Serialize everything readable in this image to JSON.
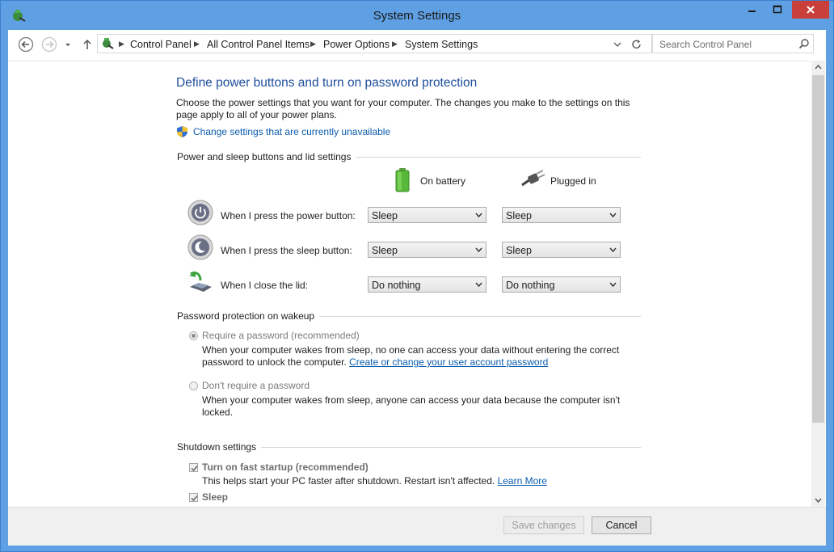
{
  "window": {
    "title": "System Settings"
  },
  "address": {
    "crumbs": [
      "Control Panel",
      "All Control Panel Items",
      "Power Options",
      "System Settings"
    ],
    "search_placeholder": "Search Control Panel"
  },
  "page": {
    "heading": "Define power buttons and turn on password protection",
    "intro_line1": "Choose the power settings that you want for your computer. The changes you make to the settings on this",
    "intro_line2": "page apply to all of your power plans.",
    "change_link": "Change settings that are currently unavailable"
  },
  "buttons_section": {
    "title": "Power and sleep buttons and lid settings",
    "col_battery": "On battery",
    "col_plugged": "Plugged in",
    "rows": [
      {
        "label": "When I press the power button:",
        "battery": "Sleep",
        "plugged": "Sleep"
      },
      {
        "label": "When I press the sleep button:",
        "battery": "Sleep",
        "plugged": "Sleep"
      },
      {
        "label": "When I close the lid:",
        "battery": "Do nothing",
        "plugged": "Do nothing"
      }
    ]
  },
  "password_section": {
    "title": "Password protection on wakeup",
    "opt1_label": "Require a password (recommended)",
    "opt1_desc1": "When your computer wakes from sleep, no one can access your data without entering the correct",
    "opt1_desc2": "password to unlock the computer.",
    "opt1_link": "Create or change your user account password",
    "opt2_label": "Don't require a password",
    "opt2_desc1": "When your computer wakes from sleep, anyone can access your data because the computer isn't",
    "opt2_desc2": "locked."
  },
  "shutdown_section": {
    "title": "Shutdown settings",
    "fast_startup_label": "Turn on fast startup (recommended)",
    "fast_startup_desc": "This helps start your PC faster after shutdown. Restart isn't affected.",
    "learn_more": "Learn More",
    "sleep_label": "Sleep"
  },
  "footer": {
    "save": "Save changes",
    "cancel": "Cancel"
  },
  "colors": {
    "title_bar": "#5fa0e4",
    "heading": "#1e4e9c",
    "link": "#0b5cad",
    "close_button": "#c9403a"
  }
}
